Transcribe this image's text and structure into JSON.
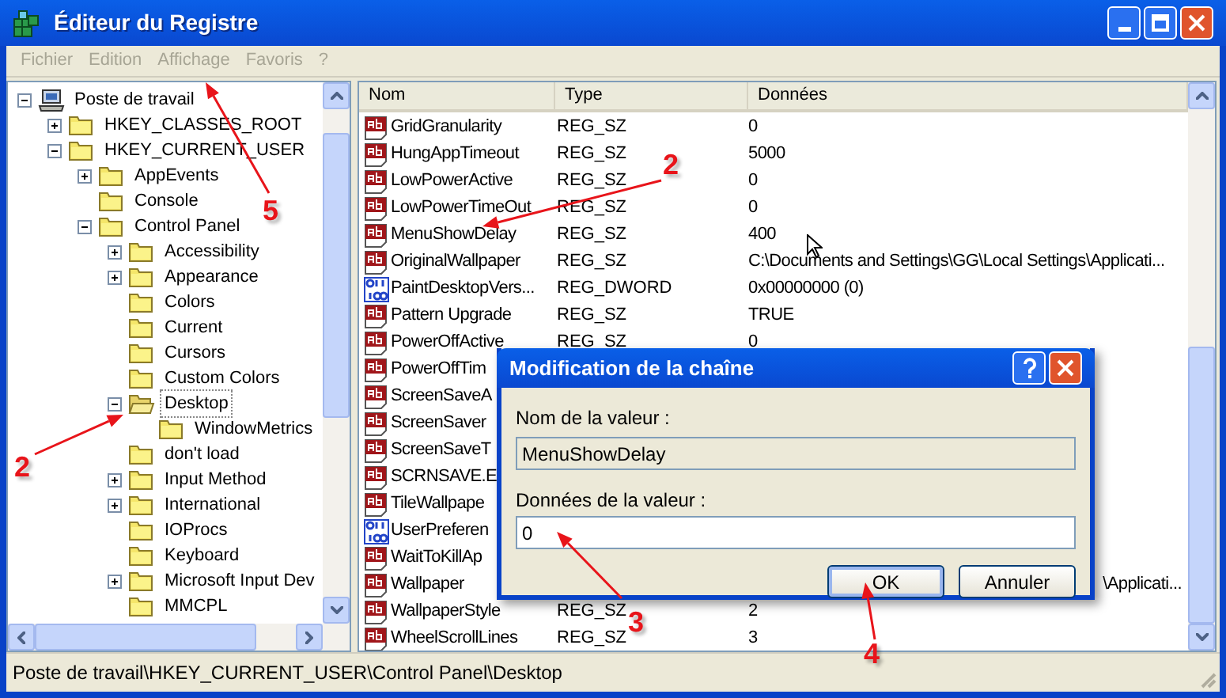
{
  "window": {
    "title": "Éditeur du Registre"
  },
  "menu": [
    {
      "label": "Fichier"
    },
    {
      "label": "Edition"
    },
    {
      "label": "Affichage"
    },
    {
      "label": "Favoris"
    },
    {
      "label": "?"
    }
  ],
  "tree": [
    {
      "label": "Poste de travail",
      "kind": "computer",
      "expanded": true,
      "selected": false,
      "children": [
        {
          "label": "HKEY_CLASSES_ROOT",
          "expanded": false,
          "selected": false
        },
        {
          "label": "HKEY_CURRENT_USER",
          "expanded": true,
          "selected": false,
          "children": [
            {
              "label": "AppEvents",
              "expanded": false,
              "selected": false
            },
            {
              "label": "Console",
              "selected": false
            },
            {
              "label": "Control Panel",
              "expanded": true,
              "selected": false,
              "children": [
                {
                  "label": "Accessibility",
                  "expanded": false,
                  "selected": false
                },
                {
                  "label": "Appearance",
                  "expanded": false,
                  "selected": false
                },
                {
                  "label": "Colors",
                  "selected": false
                },
                {
                  "label": "Current",
                  "selected": false
                },
                {
                  "label": "Cursors",
                  "selected": false
                },
                {
                  "label": "Custom Colors",
                  "selected": false
                },
                {
                  "label": "Desktop",
                  "expanded": true,
                  "selected": true,
                  "children": [
                    {
                      "label": "WindowMetrics",
                      "selected": false
                    }
                  ]
                },
                {
                  "label": "don't load",
                  "selected": false
                },
                {
                  "label": "Input Method",
                  "expanded": false,
                  "selected": false
                },
                {
                  "label": "International",
                  "expanded": false,
                  "selected": false
                },
                {
                  "label": "IOProcs",
                  "selected": false
                },
                {
                  "label": "Keyboard",
                  "selected": false
                },
                {
                  "label": "Microsoft Input Dev",
                  "expanded": false,
                  "selected": false
                },
                {
                  "label": "MMCPL",
                  "selected": false
                }
              ]
            }
          ]
        }
      ]
    }
  ],
  "table": {
    "columns": [
      "Nom",
      "Type",
      "Données"
    ],
    "rows": [
      {
        "kind": "string",
        "name": "GridGranularity",
        "type": "REG_SZ",
        "data": "0"
      },
      {
        "kind": "string",
        "name": "HungAppTimeout",
        "type": "REG_SZ",
        "data": "5000"
      },
      {
        "kind": "string",
        "name": "LowPowerActive",
        "type": "REG_SZ",
        "data": "0"
      },
      {
        "kind": "string",
        "name": "LowPowerTimeOut",
        "type": "REG_SZ",
        "data": "0"
      },
      {
        "kind": "string",
        "name": "MenuShowDelay",
        "type": "REG_SZ",
        "data": "400"
      },
      {
        "kind": "string",
        "name": "OriginalWallpaper",
        "type": "REG_SZ",
        "data": "C:\\Documents and Settings\\GG\\Local Settings\\Applicati..."
      },
      {
        "kind": "binary",
        "name": "PaintDesktopVers...",
        "type": "REG_DWORD",
        "data": "0x00000000 (0)"
      },
      {
        "kind": "string",
        "name": "Pattern Upgrade",
        "type": "REG_SZ",
        "data": "TRUE"
      },
      {
        "kind": "string",
        "name": "PowerOffActive",
        "type": "REG_SZ",
        "data": "0"
      },
      {
        "kind": "string",
        "name": "PowerOffTim"
      },
      {
        "kind": "string",
        "name": "ScreenSaveA"
      },
      {
        "kind": "string",
        "name": "ScreenSaver"
      },
      {
        "kind": "string",
        "name": "ScreenSaveT"
      },
      {
        "kind": "string",
        "name": "SCRNSAVE.E"
      },
      {
        "kind": "string",
        "name": "TileWallpape"
      },
      {
        "kind": "binary",
        "name": "UserPreferen"
      },
      {
        "kind": "string",
        "name": "WaitToKillAp"
      },
      {
        "kind": "string",
        "name": "Wallpaper",
        "data": "\\Applicati..."
      },
      {
        "kind": "string",
        "name": "WallpaperStyle",
        "type": "REG_SZ",
        "data": "2"
      },
      {
        "kind": "string",
        "name": "WheelScrollLines",
        "type": "REG_SZ",
        "data": "3"
      }
    ]
  },
  "status_bar": "Poste de travail\\HKEY_CURRENT_USER\\Control Panel\\Desktop",
  "dialog": {
    "title": "Modification de la chaîne",
    "name_label": "Nom de la valeur :",
    "name_value": "MenuShowDelay",
    "data_label": "Données de la valeur :",
    "data_value": "0",
    "buttons": [
      {
        "label": "OK",
        "default": true
      },
      {
        "label": "Annuler",
        "default": false
      }
    ]
  },
  "annotations": [
    {
      "label": "5"
    },
    {
      "label": "2"
    },
    {
      "label": "2"
    },
    {
      "label": "3"
    },
    {
      "label": "4"
    }
  ]
}
